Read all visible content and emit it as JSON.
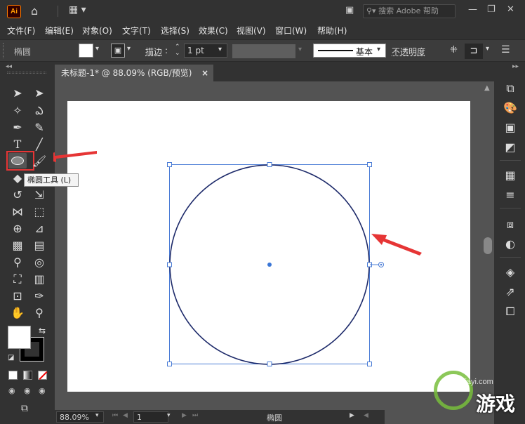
{
  "app": {
    "logo_text": "Ai"
  },
  "search": {
    "placeholder": "搜索 Adobe 帮助"
  },
  "menu": [
    "文件(F)",
    "编辑(E)",
    "对象(O)",
    "文字(T)",
    "选择(S)",
    "效果(C)",
    "视图(V)",
    "窗口(W)",
    "帮助(H)"
  ],
  "control_bar": {
    "object_name": "椭圆",
    "stroke_label": "描边",
    "stroke_value": "1 pt",
    "brush_value": "基本",
    "opacity_label": "不透明度"
  },
  "document": {
    "tab_title": "未标题-1* @ 88.09% (RGB/预览)",
    "close_label": "×"
  },
  "tooltip": {
    "text": "椭圆工具 (L)"
  },
  "status": {
    "zoom": "88.09%",
    "page": "1",
    "tool_name": "椭圆"
  },
  "watermark": {
    "text": "游戏",
    "url": "jiayi.com"
  },
  "colors": {
    "accent": "#3a76d6",
    "selection": "#4a7cd6",
    "annotation_red": "#e63535"
  }
}
